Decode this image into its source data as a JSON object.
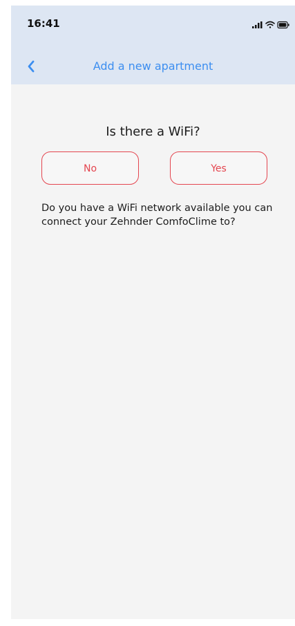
{
  "status_bar": {
    "time": "16:41",
    "icons": [
      "signal-icon",
      "wifi-icon",
      "battery-icon"
    ]
  },
  "nav": {
    "back_icon": "chevron-left-icon",
    "title": "Add a new apartment"
  },
  "content": {
    "question": "Is there a WiFi?",
    "no_label": "No",
    "yes_label": "Yes",
    "description": "Do you have a WiFi network available you can connect your Zehnder ComfoClime to?"
  },
  "colors": {
    "accent_blue": "#3c8ef0",
    "accent_red": "#e4454f",
    "header_bg": "#dde6f3",
    "page_bg": "#f4f4f4"
  }
}
